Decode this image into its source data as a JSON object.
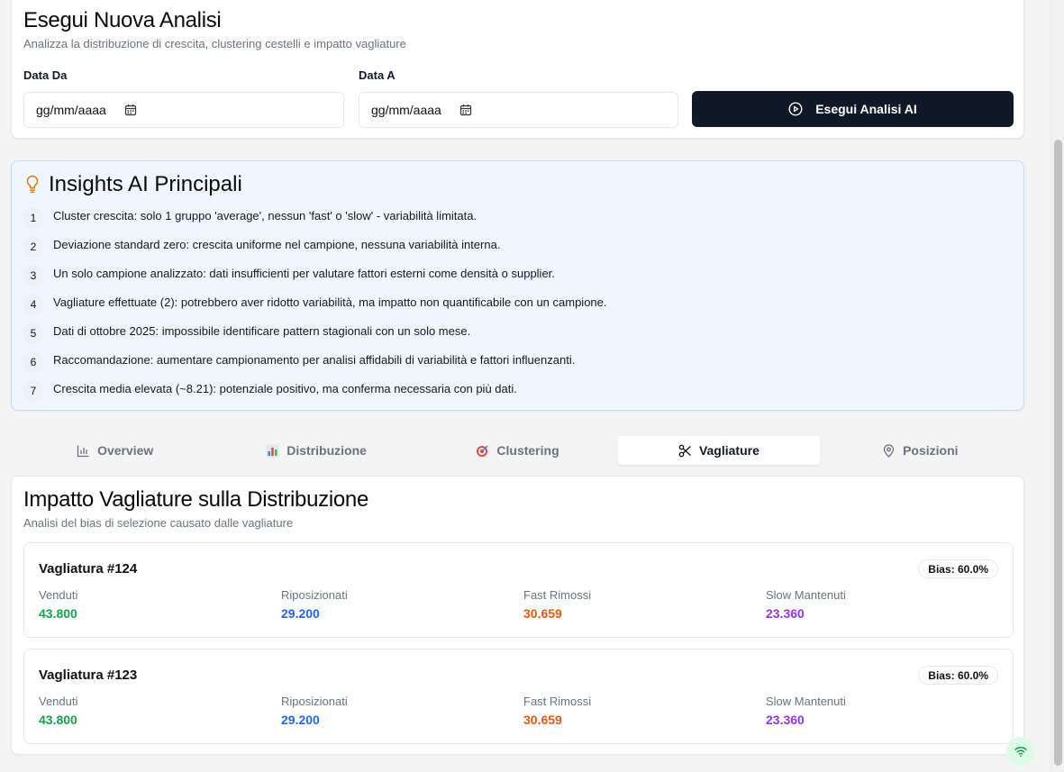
{
  "analisi": {
    "title": "Esegui Nuova Analisi",
    "subtitle": "Analizza la distribuzione di crescita, clustering cestelli e impatto vagliature",
    "data_da_label": "Data Da",
    "data_a_label": "Data A",
    "date_placeholder": "gg/mm/aaaa",
    "run_button": "Esegui Analisi AI"
  },
  "insights": {
    "title": "Insights AI Principali",
    "items": [
      {
        "n": "1",
        "text": "Cluster crescita: solo 1 gruppo 'average', nessun 'fast' o 'slow' - variabilità limitata."
      },
      {
        "n": "2",
        "text": "Deviazione standard zero: crescita uniforme nel campione, nessuna variabilità interna."
      },
      {
        "n": "3",
        "text": "Un solo campione analizzato: dati insufficienti per valutare fattori esterni come densità o supplier."
      },
      {
        "n": "4",
        "text": "Vagliature effettuate (2): potrebbero aver ridotto variabilità, ma impatto non quantificabile con un campione."
      },
      {
        "n": "5",
        "text": "Dati di ottobre 2025: impossibile identificare pattern stagionali con un solo mese."
      },
      {
        "n": "6",
        "text": "Raccomandazione: aumentare campionamento per analisi affidabili di variabilità e fattori influenzanti."
      },
      {
        "n": "7",
        "text": "Crescita media elevata (~8.21): potenziale positivo, ma conferma necessaria con più dati."
      }
    ]
  },
  "tabs": [
    {
      "label": "Overview",
      "icon": "bar-chart-icon",
      "active": false
    },
    {
      "label": "Distribuzione",
      "icon": "chart-emoji-icon",
      "active": false
    },
    {
      "label": "Clustering",
      "icon": "target-icon",
      "active": false
    },
    {
      "label": "Vagliature",
      "icon": "scissors-icon",
      "active": true
    },
    {
      "label": "Posizioni",
      "icon": "map-pin-icon",
      "active": false
    }
  ],
  "vagliature": {
    "title": "Impatto Vagliature sulla Distribuzione",
    "subtitle": "Analisi del bias di selezione causato dalle vagliature",
    "metric_labels": {
      "venduti": "Venduti",
      "riposizionati": "Riposizionati",
      "fast_rimossi": "Fast Rimossi",
      "slow_mantenuti": "Slow Mantenuti"
    },
    "items": [
      {
        "title": "Vagliatura #124",
        "bias": "Bias: 60.0%",
        "venduti": "43.800",
        "riposizionati": "29.200",
        "fast_rimossi": "30.659",
        "slow_mantenuti": "23.360"
      },
      {
        "title": "Vagliatura #123",
        "bias": "Bias: 60.0%",
        "venduti": "43.800",
        "riposizionati": "29.200",
        "fast_rimossi": "30.659",
        "slow_mantenuti": "23.360"
      }
    ]
  },
  "colors": {
    "venduti": "#16a34a",
    "riposizionati": "#2563eb",
    "fast_rimossi": "#ea580c",
    "slow_mantenuti": "#9333ea",
    "primary_button": "#111827",
    "insights_bg": "#eff6ff"
  }
}
